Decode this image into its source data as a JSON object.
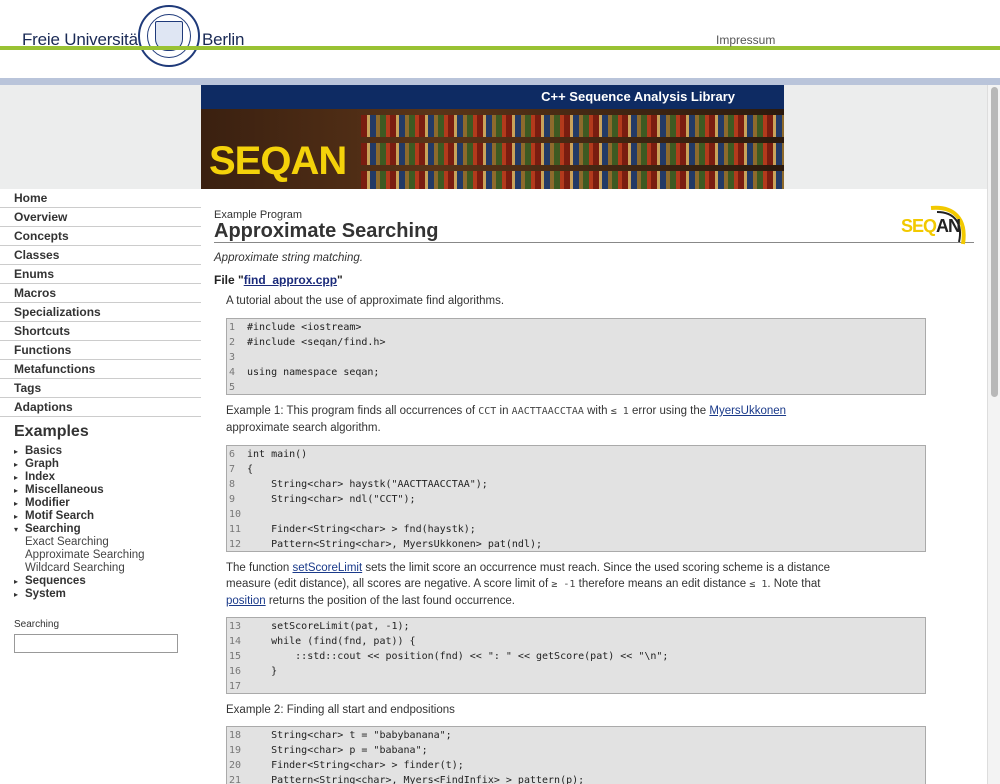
{
  "header": {
    "uni_left": "Freie Universität",
    "uni_right": "Berlin",
    "impressum": "Impressum"
  },
  "banner": {
    "title": "C++ Sequence Analysis Library",
    "logo_text": "SEQAN"
  },
  "sidebar": {
    "nav": [
      "Home",
      "Overview",
      "Concepts",
      "Classes",
      "Enums",
      "Macros",
      "Specializations",
      "Shortcuts",
      "Functions",
      "Metafunctions",
      "Tags",
      "Adaptions"
    ],
    "examples_title": "Examples",
    "examples": [
      {
        "label": "Basics",
        "tri": "▸"
      },
      {
        "label": "Graph",
        "tri": "▸"
      },
      {
        "label": "Index",
        "tri": "▸"
      },
      {
        "label": "Miscellaneous",
        "tri": "▸"
      },
      {
        "label": "Modifier",
        "tri": "▸"
      },
      {
        "label": "Motif Search",
        "tri": "▸"
      },
      {
        "label": "Searching",
        "tri": "▾"
      }
    ],
    "searching_sub": [
      "Exact Searching",
      "Approximate Searching",
      "Wildcard Searching"
    ],
    "examples_after": [
      {
        "label": "Sequences",
        "tri": "▸"
      },
      {
        "label": "System",
        "tri": "▸"
      }
    ],
    "search_label": "Searching",
    "search_value": ""
  },
  "main": {
    "eyebrow": "Example Program",
    "title": "Approximate Searching",
    "subtitle": "Approximate string matching.",
    "file_prefix": "File \"",
    "file_name": "find_approx.cpp",
    "file_suffix": "\"",
    "intro": "A tutorial about the use of approximate find algorithms.",
    "ex1": {
      "a": "Example 1: This program finds all occurrences of ",
      "code1": "CCT",
      "b": " in ",
      "code2": "AACTTAACCTAA",
      "c": " with ",
      "code3": "≤ 1",
      "d": " error using the ",
      "link": "MyersUkkonen",
      "e": "approximate search algorithm."
    },
    "para3": {
      "a": "The function ",
      "link1": "setScoreLimit",
      "b": " sets the limit score an occurrence must reach. Since the used scoring scheme is a distance",
      "c": "measure (edit distance), all scores are negative. A score limit of ",
      "code1": "≥ -1",
      "d": " therefore means an edit distance ",
      "code2": "≤ 1",
      "e": ". Note that",
      "link2": "position",
      "f": " returns the position of the last found occurrence."
    },
    "ex2": "Example 2: Finding all start and endpositions",
    "code_blocks": [
      [
        {
          "n": "1",
          "t": "#include <iostream>"
        },
        {
          "n": "2",
          "t": "#include <seqan/find.h>"
        },
        {
          "n": "3",
          "t": ""
        },
        {
          "n": "4",
          "t": "using namespace seqan;"
        },
        {
          "n": "5",
          "t": ""
        }
      ],
      [
        {
          "n": "6",
          "t": "int main()"
        },
        {
          "n": "7",
          "t": "{"
        },
        {
          "n": "8",
          "t": "    String<char> haystk(\"AACTTAACCTAA\");"
        },
        {
          "n": "9",
          "t": "    String<char> ndl(\"CCT\");"
        },
        {
          "n": "10",
          "t": ""
        },
        {
          "n": "11",
          "t": "    Finder<String<char> > fnd(haystk);"
        },
        {
          "n": "12",
          "t": "    Pattern<String<char>, MyersUkkonen> pat(ndl);"
        }
      ],
      [
        {
          "n": "13",
          "t": "    setScoreLimit(pat, -1);"
        },
        {
          "n": "14",
          "t": "    while (find(fnd, pat)) {"
        },
        {
          "n": "15",
          "t": "        ::std::cout << position(fnd) << \": \" << getScore(pat) << \"\\n\";"
        },
        {
          "n": "16",
          "t": "    }"
        },
        {
          "n": "17",
          "t": ""
        }
      ],
      [
        {
          "n": "18",
          "t": "    String<char> t = \"babybanana\";"
        },
        {
          "n": "19",
          "t": "    String<char> p = \"babana\";"
        },
        {
          "n": "20",
          "t": "    Finder<String<char> > finder(t);"
        },
        {
          "n": "21",
          "t": "    Pattern<String<char>, Myers<FindInfix> > pattern(p);"
        }
      ]
    ]
  },
  "colors": {
    "accent_green": "#99c233",
    "banner_navy": "#0e2b63",
    "link_blue": "#1a3a8a",
    "logo_yellow": "#f4d20a"
  }
}
